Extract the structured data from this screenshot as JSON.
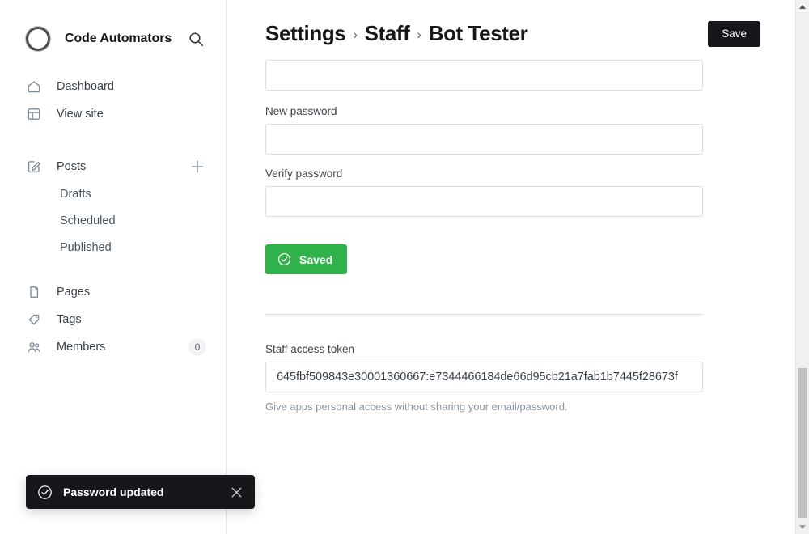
{
  "sidebar": {
    "brand": {
      "name": "Code Automators",
      "logo_icon": "circle-ring-logo",
      "search_icon": "search-icon"
    },
    "items": [
      {
        "label": "Dashboard",
        "icon": "home-icon"
      },
      {
        "label": "View site",
        "icon": "layout-icon"
      },
      {
        "label": "Posts",
        "icon": "pencil-square-icon",
        "action_icon": "plus-icon"
      },
      {
        "label": "Drafts",
        "icon": ""
      },
      {
        "label": "Scheduled",
        "icon": ""
      },
      {
        "label": "Published",
        "icon": ""
      },
      {
        "label": "Pages",
        "icon": "book-icon"
      },
      {
        "label": "Tags",
        "icon": "tag-icon"
      },
      {
        "label": "Members",
        "icon": "people-icon",
        "badge": "0"
      }
    ]
  },
  "header": {
    "breadcrumb": [
      "Settings",
      "Staff",
      "Bot Tester"
    ],
    "separator": "›",
    "save_label": "Save",
    "save_bg": "#15171a"
  },
  "form": {
    "old_password": {
      "label": "",
      "value": "",
      "placeholder": ""
    },
    "new_password": {
      "label": "New password",
      "value": "",
      "placeholder": ""
    },
    "verify_password": {
      "label": "Verify password",
      "value": "",
      "placeholder": ""
    },
    "saved_button": {
      "label": "Saved",
      "icon": "check-circle-icon",
      "bg": "#30b24a"
    },
    "token": {
      "label": "Staff access token",
      "value": "645fbf509843e30001360667:e7344466184de66d95cb21a7fab1b7445f28673f",
      "hint": "Give apps personal access without sharing your email/password."
    }
  },
  "toast": {
    "message": "Password updated",
    "icon": "check-circle-icon",
    "close_icon": "close-icon",
    "bg": "#15171a"
  },
  "scrollbar": {
    "up_icon": "triangle-up-icon",
    "down_icon": "triangle-down-icon",
    "thumb_top_px": "455",
    "thumb_height_px": "185"
  }
}
